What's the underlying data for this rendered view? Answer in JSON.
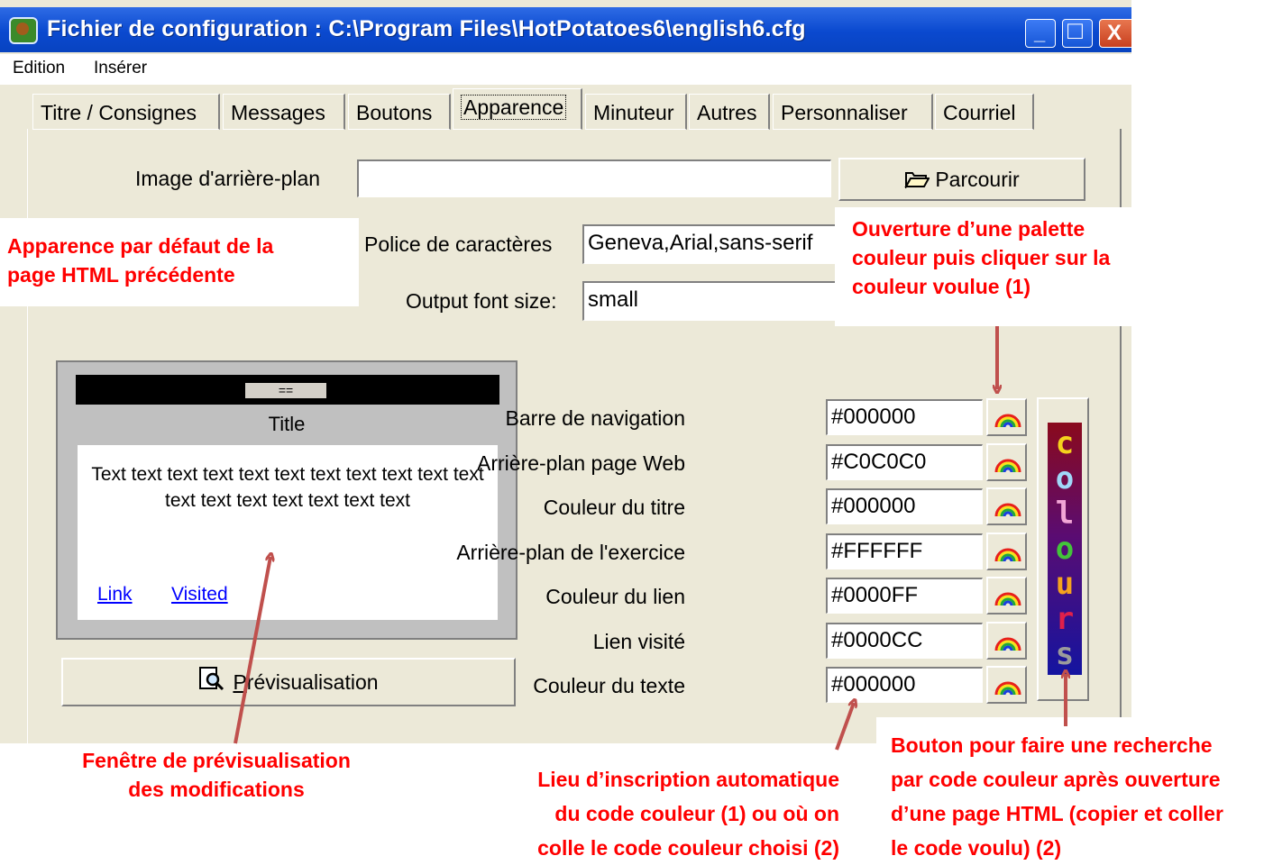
{
  "window": {
    "title": "Fichier de configuration : C:\\Program Files\\HotPotatoes6\\english6.cfg",
    "minimize_glyph": "_",
    "maximize_glyph": "□",
    "close_glyph": "X"
  },
  "menu": [
    "Edition",
    "Insérer"
  ],
  "tabs": [
    {
      "label": "Titre / Consignes"
    },
    {
      "label": "Messages"
    },
    {
      "label": "Boutons"
    },
    {
      "label": "Apparence",
      "active": true
    },
    {
      "label": "Minuteur"
    },
    {
      "label": "Autres"
    },
    {
      "label": "Personnaliser"
    },
    {
      "label": "Courriel"
    }
  ],
  "form": {
    "background_image_label": "Image d'arrière-plan",
    "background_image_value": "",
    "browse_button": "Parcourir",
    "font_label": "Police de caractères",
    "font_value": "Geneva,Arial,sans-serif",
    "font_size_label": "Output font size:",
    "font_size_value": "small"
  },
  "preview": {
    "nav_button": "==",
    "title": "Title",
    "body_text": "Text text text text text text text text text text text text text text text text text text",
    "link": "Link",
    "visited": "Visited",
    "preview_button": "Prévisualisation",
    "preview_button_mnemonic": "P"
  },
  "colors": [
    {
      "label": "Barre de navigation",
      "value": "#000000"
    },
    {
      "label": "Arrière-plan page Web",
      "value": "#C0C0C0"
    },
    {
      "label": "Couleur du titre",
      "value": "#000000"
    },
    {
      "label": "Arrière-plan de l'exercice",
      "value": "#FFFFFF"
    },
    {
      "label": "Couleur du lien",
      "value": "#0000FF"
    },
    {
      "label": "Lien visité",
      "value": "#0000CC"
    },
    {
      "label": "Couleur du texte",
      "value": "#000000"
    }
  ],
  "colours_button": {
    "letters": [
      "c",
      "o",
      "l",
      "o",
      "u",
      "r",
      "s"
    ],
    "letter_colors": [
      "#f4d21c",
      "#a0d8f8",
      "#f2a6d6",
      "#43c43a",
      "#f5a31e",
      "#e0204a",
      "#9b9b9b"
    ]
  },
  "annotations": {
    "default_appearance": [
      "Apparence par défaut de la",
      "page HTML précédente"
    ],
    "palette": [
      "Ouverture d’une palette",
      "couleur puis cliquer sur la",
      "couleur voulue (1)"
    ],
    "preview_window": [
      "Fenêtre de prévisualisation",
      "des modifications"
    ],
    "color_code_place": [
      "Lieu d’inscription automatique",
      "du code couleur (1) ou où on",
      "colle le code couleur choisi (2)"
    ],
    "search_button": [
      "Bouton pour faire une recherche",
      "par code couleur après ouverture",
      "d’une page HTML (copier et coller",
      "le code voulu) (2)"
    ]
  },
  "theme": {
    "annotation_color": "#ff0000",
    "arrow_color": "#c0504d",
    "titlebar_color": "#0a49cf"
  }
}
